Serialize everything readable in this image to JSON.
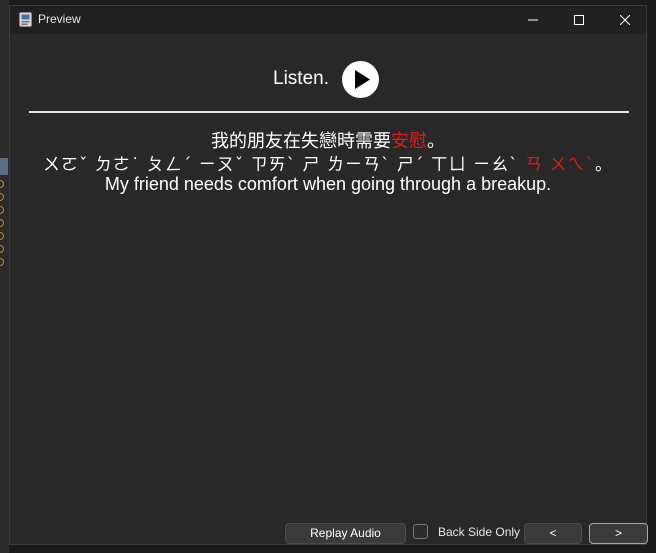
{
  "window": {
    "title": "Preview"
  },
  "card": {
    "listen_label": "Listen.",
    "sentence_cn": {
      "before": "我的朋友在失戀時需要",
      "highlight": "安慰",
      "after": "。"
    },
    "sentence_zhuyin": {
      "before": "ㄨㄛˇ ㄉㄜ˙ ㄆㄥˊ ㄧㄡˇ ㄗㄞˋ ㄕ ㄌㄧㄢˋ ㄕˊ ㄒㄩ ㄧㄠˋ ",
      "highlight": "ㄢ ㄨㄟˋ",
      "after": "。"
    },
    "sentence_en": "My friend needs comfort when going through a breakup.",
    "highlight_color": "#e0191e"
  },
  "controls": {
    "replay_label": "Replay Audio",
    "back_side_label": "Back Side Only",
    "back_side_checked": false,
    "prev_label": "<",
    "next_label": ">"
  },
  "icons": {
    "app": "app-icon",
    "minimize": "minimize-icon",
    "maximize": "maximize-icon",
    "close": "close-icon",
    "play": "play-icon"
  }
}
